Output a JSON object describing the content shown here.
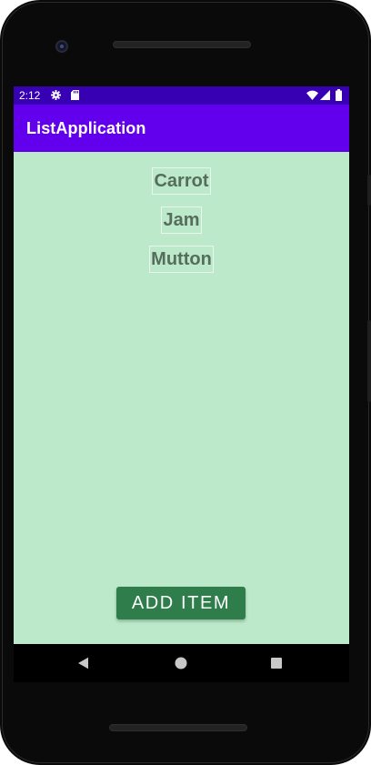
{
  "status_bar": {
    "time": "2:12",
    "icons": [
      "settings-gear-icon",
      "sd-card-icon",
      "wifi-icon",
      "cell-signal-icon",
      "battery-icon"
    ]
  },
  "app_bar": {
    "title": "ListApplication"
  },
  "list": {
    "items": [
      {
        "label": "Carrot"
      },
      {
        "label": "Jam"
      },
      {
        "label": "Mutton"
      }
    ]
  },
  "actions": {
    "add_item_label": "ADD ITEM"
  },
  "nav_bar": {
    "icons": [
      "back-icon",
      "home-icon",
      "recents-icon"
    ]
  },
  "colors": {
    "status_bar": "#3700b3",
    "app_bar": "#6200ee",
    "background": "#bbe9c9",
    "button": "#2e7d4a",
    "item_text": "#566d5d"
  }
}
